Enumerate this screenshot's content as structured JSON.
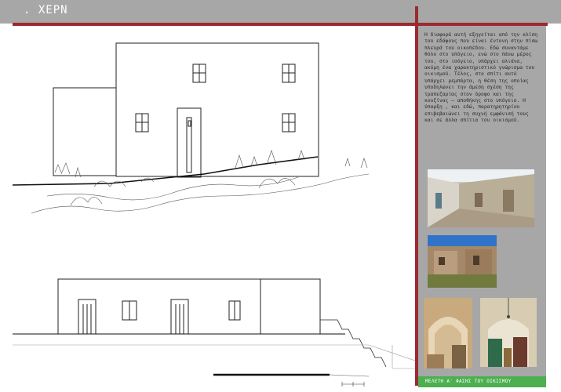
{
  "header": {
    "title": ". ΧΕΡΝ"
  },
  "sidebar": {
    "description": "Η διαφορά αυτή εξηγείται από την κλίση του εδάφους που είναι έντονη στην πίσω πλευρά του οικοπέδου. Εδώ συναντάμε θόλο στο υπόγειο, ενώ στο πάνω μέρος του, στο ισόγειο, υπάρχει αλιάνα, ακόμη ένα χαρακτηριστικό γνώρισμα του οικισμού. Τέλος, στο σπίτι αυτό υπάρχει ρεμπάρτα, η θέση της οποίας υποδηλώνει την άμεση σχέση της τραπεζαρίας στον όροφο και της κουζίνας – αποθήκης στο υπόγειο. Η ύπαρξη , και εδώ, παρατηρητηρίου επιβεβαιώνει τη συχνή εμφάνισή τους και σε άλλα σπίτια του οικισμού.",
    "photos": [
      "street-photo",
      "courtyard-photo",
      "vault-photo",
      "interior-photo"
    ]
  },
  "footer": {
    "label": "ΜΕΛΕΤΗ Α' ΦΑΣΗΣ ΤΟΥ ΟΙΚΙΣΜΟΥ"
  },
  "colors": {
    "accent_red": "#9b2a2f",
    "panel_gray": "#a7a7a7",
    "footer_green": "#4caf50"
  }
}
